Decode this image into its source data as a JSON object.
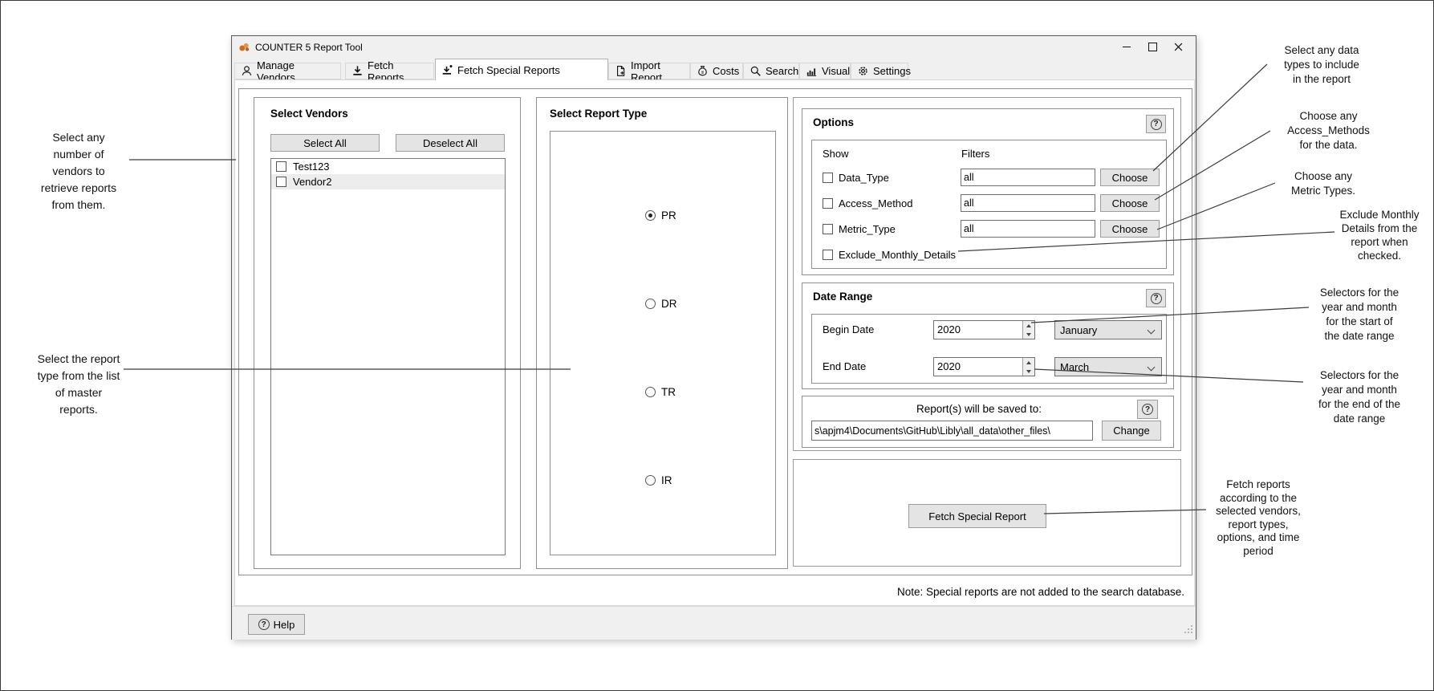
{
  "colors": {
    "logo_orange": "#d9822b",
    "selection_gray": "#ededed"
  },
  "glyphs": {
    "question": "?"
  },
  "window": {
    "title": "COUNTER 5 Report Tool",
    "app_icon": "counter-logo-icon"
  },
  "tabs": [
    {
      "label": "Manage Vendors",
      "icon": "person-icon",
      "active": false
    },
    {
      "label": "Fetch Reports",
      "icon": "download-icon",
      "active": false
    },
    {
      "label": "Fetch Special Reports",
      "icon": "download-star-icon",
      "active": true
    },
    {
      "label": "Import Report",
      "icon": "import-document-icon",
      "active": false
    },
    {
      "label": "Costs",
      "icon": "money-bag-icon",
      "active": false
    },
    {
      "label": "Search",
      "icon": "search-icon",
      "active": false
    },
    {
      "label": "Visual",
      "icon": "bar-chart-icon",
      "active": false
    },
    {
      "label": "Settings",
      "icon": "gear-icon",
      "active": false
    }
  ],
  "vendors_panel": {
    "title": "Select Vendors",
    "select_all": "Select All",
    "deselect_all": "Deselect All",
    "vendors": [
      {
        "label": "Test123",
        "checked": false
      },
      {
        "label": "Vendor2",
        "checked": false
      }
    ]
  },
  "report_type_panel": {
    "title": "Select Report Type",
    "options": [
      {
        "label": "PR",
        "selected": true
      },
      {
        "label": "DR",
        "selected": false
      },
      {
        "label": "TR",
        "selected": false
      },
      {
        "label": "IR",
        "selected": false
      }
    ]
  },
  "options_panel": {
    "title": "Options",
    "show_header": "Show",
    "filters_header": "Filters",
    "rows": [
      {
        "label": "Data_Type",
        "filter_value": "all",
        "button": "Choose",
        "checked": false
      },
      {
        "label": "Access_Method",
        "filter_value": "all",
        "button": "Choose",
        "checked": false
      },
      {
        "label": "Metric_Type",
        "filter_value": "all",
        "button": "Choose",
        "checked": false
      }
    ],
    "exclude_label": "Exclude_Monthly_Details",
    "exclude_checked": false
  },
  "date_range_panel": {
    "title": "Date Range",
    "begin_label": "Begin Date",
    "begin_year": "2020",
    "begin_month": "January",
    "end_label": "End Date",
    "end_year": "2020",
    "end_month": "March"
  },
  "save_panel": {
    "header": "Report(s) will be saved to:",
    "path": "s\\apjm4\\Documents\\GitHub\\Libly\\all_data\\other_files\\",
    "change_button": "Change"
  },
  "fetch_panel": {
    "button": "Fetch Special Report"
  },
  "note": "Note: Special reports are not added to the search database.",
  "help_button": "Help",
  "annotations": {
    "vendors": "Select any\nnumber of\nvendors to\nretrieve reports\nfrom them.",
    "report_type": "Select the report\ntype from the list\nof master\nreports.",
    "data_types": "Select any data\ntypes to include\nin the report",
    "access_methods": "Choose any\nAccess_Methods\nfor the data.",
    "metric_types": "Choose any\nMetric Types.",
    "exclude_monthly": "Exclude Monthly\nDetails from the\nreport when\nchecked.",
    "start_selectors": "Selectors for the\nyear and month\nfor the start of\nthe date range",
    "end_selectors": "Selectors for the\nyear and month\nfor the end of the\ndate range",
    "fetch": "Fetch reports\naccording to the\nselected vendors,\nreport types,\noptions, and time\nperiod"
  }
}
